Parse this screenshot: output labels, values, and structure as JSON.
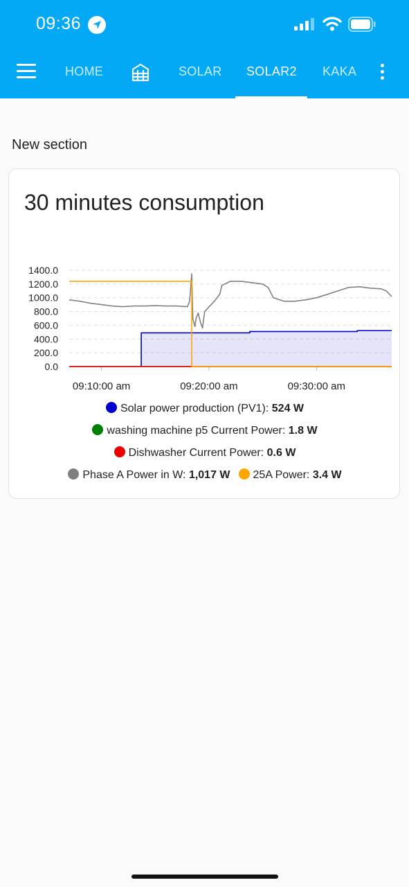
{
  "status_bar": {
    "time": "09:36",
    "icons": [
      "location-arrow-icon",
      "cellular-signal-icon",
      "wifi-icon",
      "battery-icon"
    ]
  },
  "nav": {
    "tabs": [
      {
        "label": "HOME",
        "active": false
      },
      {
        "icon": "building-icon",
        "active": false
      },
      {
        "label": "SOLAR",
        "active": false
      },
      {
        "label": "SOLAR2",
        "active": true
      },
      {
        "label": "KAKA",
        "active": false
      }
    ],
    "colors": {
      "header": "#03a9f4"
    }
  },
  "section_title": "New section",
  "card": {
    "title": "30 minutes consumption"
  },
  "chart_data": {
    "type": "line",
    "title": "30 minutes consumption",
    "ylim": [
      0,
      1400
    ],
    "y_ticks": [
      "1400.0",
      "1200.0",
      "1000.0",
      "800.0",
      "600.0",
      "400.0",
      "200.0",
      "0.0"
    ],
    "x_tick_labels": [
      "09:10:00 am",
      "09:20:00 am",
      "09:30:00 am"
    ],
    "x_ticks_min": [
      10,
      20,
      30
    ],
    "x_range_min": [
      7,
      37
    ],
    "grid": true,
    "legend_position": "bottom",
    "series": [
      {
        "name": "Solar power production (PV1)",
        "value_label": "524 W",
        "color": "#0000cc",
        "fill": true,
        "points": [
          [
            13.7,
            0
          ],
          [
            13.7,
            490
          ],
          [
            23.8,
            490
          ],
          [
            23.8,
            510
          ],
          [
            33.8,
            510
          ],
          [
            33.8,
            524
          ],
          [
            37,
            524
          ]
        ]
      },
      {
        "name": "washing machine p5 Current Power",
        "value_label": "1.8 W",
        "color": "#008000",
        "fill": false,
        "points": [
          [
            7,
            1.8
          ],
          [
            37,
            1.8
          ]
        ]
      },
      {
        "name": "Dishwasher Current Power",
        "value_label": "0.6 W",
        "color": "#ee0000",
        "fill": false,
        "points": [
          [
            7,
            0.6
          ],
          [
            37,
            0.6
          ]
        ]
      },
      {
        "name": "Phase A Power in W",
        "value_label": "1,017 W",
        "color": "#808080",
        "fill": false,
        "points": [
          [
            7,
            970
          ],
          [
            8,
            950
          ],
          [
            9,
            920
          ],
          [
            10,
            900
          ],
          [
            11,
            880
          ],
          [
            12,
            870
          ],
          [
            13,
            880
          ],
          [
            14,
            880
          ],
          [
            15,
            885
          ],
          [
            16,
            880
          ],
          [
            17,
            880
          ],
          [
            18,
            870
          ],
          [
            18.2,
            950
          ],
          [
            18.4,
            1350
          ],
          [
            18.5,
            700
          ],
          [
            18.7,
            580
          ],
          [
            18.8,
            700
          ],
          [
            19.0,
            780
          ],
          [
            19.2,
            650
          ],
          [
            19.4,
            560
          ],
          [
            19.6,
            800
          ],
          [
            20.5,
            950
          ],
          [
            21,
            1050
          ],
          [
            21.2,
            1180
          ],
          [
            22,
            1240
          ],
          [
            23,
            1240
          ],
          [
            24,
            1220
          ],
          [
            25,
            1200
          ],
          [
            25.5,
            1150
          ],
          [
            26,
            1000
          ],
          [
            27,
            950
          ],
          [
            28,
            950
          ],
          [
            29,
            970
          ],
          [
            30,
            1000
          ],
          [
            31,
            1050
          ],
          [
            32,
            1100
          ],
          [
            33,
            1150
          ],
          [
            34,
            1160
          ],
          [
            35,
            1140
          ],
          [
            36,
            1130
          ],
          [
            36.5,
            1100
          ],
          [
            37,
            1017
          ]
        ]
      },
      {
        "name": "25A Power",
        "value_label": "3.4 W",
        "color": "#ffa500",
        "fill": false,
        "points": [
          [
            7,
            1240
          ],
          [
            18.4,
            1240
          ],
          [
            18.4,
            3.4
          ],
          [
            37,
            3.4
          ]
        ]
      }
    ]
  }
}
